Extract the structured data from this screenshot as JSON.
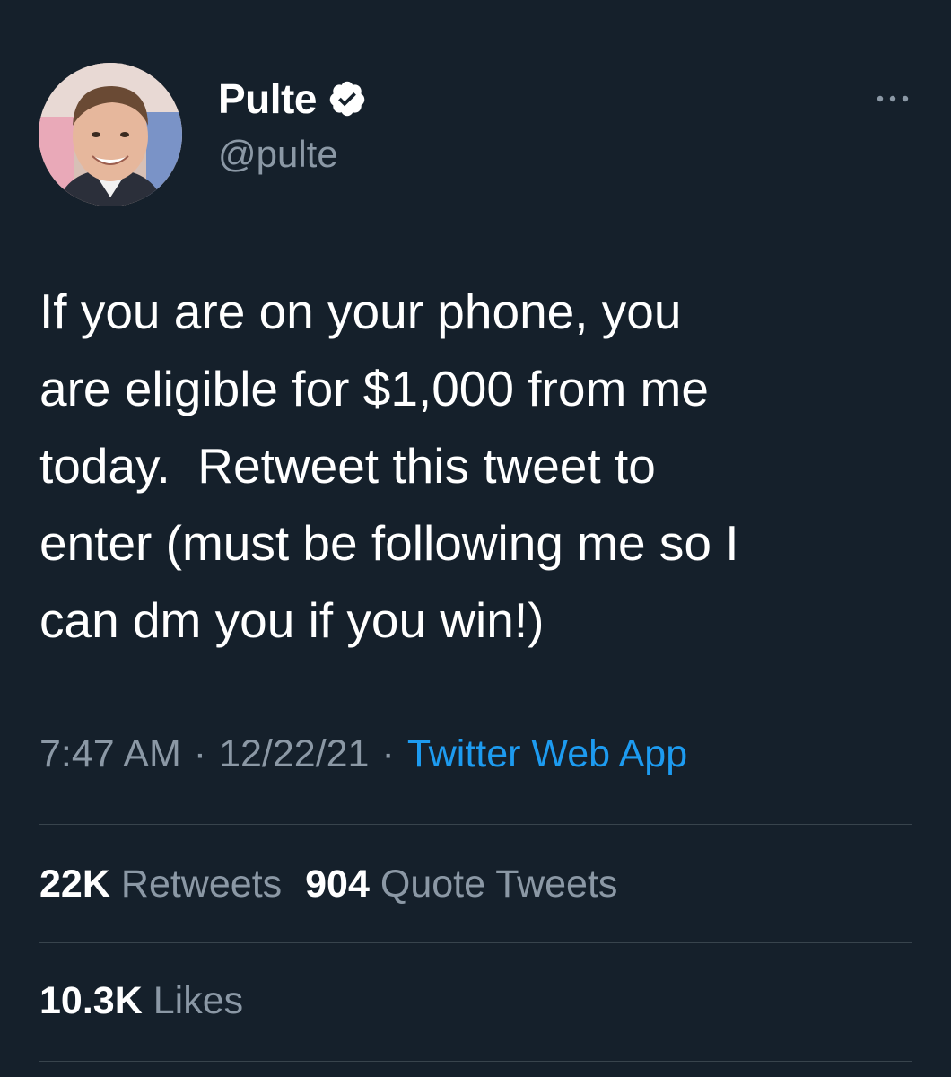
{
  "author": {
    "display_name": "Pulte",
    "handle": "@pulte",
    "verified": true
  },
  "tweet": {
    "text": "If you are on your phone, you\nare eligible for $1,000 from me\ntoday.  Retweet this tweet to\nenter (must be following me so I\ncan dm you if you win!)",
    "time": "7:47 AM",
    "date": "12/22/21",
    "separator": "·",
    "source": "Twitter Web App"
  },
  "stats": {
    "retweets_count": "22K",
    "retweets_label": "Retweets",
    "quotes_count": "904",
    "quotes_label": "Quote Tweets",
    "likes_count": "10.3K",
    "likes_label": "Likes"
  },
  "colors": {
    "background": "#15202b",
    "text_primary": "#ffffff",
    "text_secondary": "#8b98a5",
    "accent": "#1d9bf0",
    "divider": "#38444d"
  },
  "icons": {
    "verified": "verified-badge-icon",
    "more": "more-options-icon"
  }
}
